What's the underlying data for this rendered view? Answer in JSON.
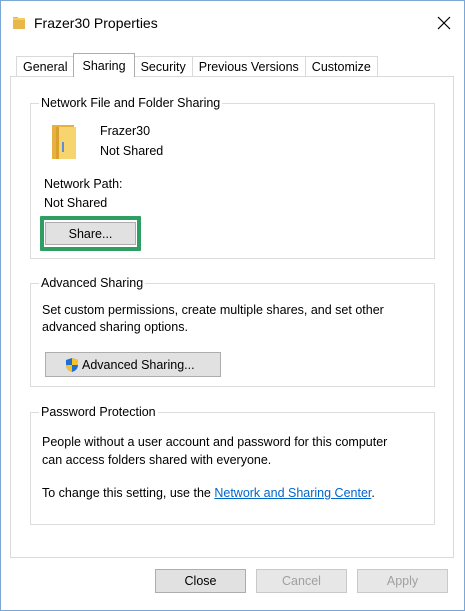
{
  "window": {
    "title": "Frazer30 Properties",
    "accent": "#7aa7d6"
  },
  "tabs": [
    {
      "label": "General",
      "active": false
    },
    {
      "label": "Sharing",
      "active": true
    },
    {
      "label": "Security",
      "active": false
    },
    {
      "label": "Previous Versions",
      "active": false
    },
    {
      "label": "Customize",
      "active": false
    }
  ],
  "network_sharing": {
    "group_label": "Network File and Folder Sharing",
    "folder_name": "Frazer30",
    "folder_status": "Not Shared",
    "network_path_label": "Network Path:",
    "network_path_value": "Not Shared",
    "share_button": "Share...",
    "highlight_color": "#2e9e62"
  },
  "advanced_sharing": {
    "group_label": "Advanced Sharing",
    "description_line1": "Set custom permissions, create multiple shares, and set other",
    "description_line2": "advanced sharing options.",
    "button_label": "Advanced Sharing..."
  },
  "password_protection": {
    "group_label": "Password Protection",
    "description_line1": "People without a user account and password for this computer",
    "description_line2": "can access folders shared with everyone.",
    "change_prefix": "To change this setting, use the ",
    "link_text": "Network and Sharing Center",
    "change_suffix": "."
  },
  "footer": {
    "close_label": "Close",
    "cancel_label": "Cancel",
    "apply_label": "Apply"
  },
  "icons": {
    "title_icon": "folder-icon",
    "folder_icon": "folder-icon",
    "shield_icon": "uac-shield-icon",
    "close_icon": "close-icon"
  }
}
